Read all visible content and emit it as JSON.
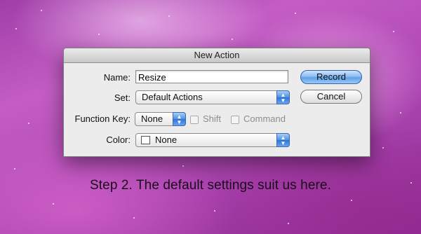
{
  "dialog": {
    "title": "New Action",
    "name_label": "Name:",
    "name_value": "Resize",
    "set_label": "Set:",
    "set_value": "Default Actions",
    "function_key_label": "Function Key:",
    "function_key_value": "None",
    "shift_label": "Shift",
    "command_label": "Command",
    "color_label": "Color:",
    "color_value": "None",
    "record_label": "Record",
    "cancel_label": "Cancel",
    "arrows_glyph": "▲\n▼"
  },
  "caption": "Step 2. The default settings suit us here.",
  "icons": [
    "popup-arrows-icon",
    "color-swatch-icon"
  ],
  "colors": {
    "record_button": "#5fa0eb",
    "background": "#b149b6",
    "dialog": "#ececec"
  }
}
